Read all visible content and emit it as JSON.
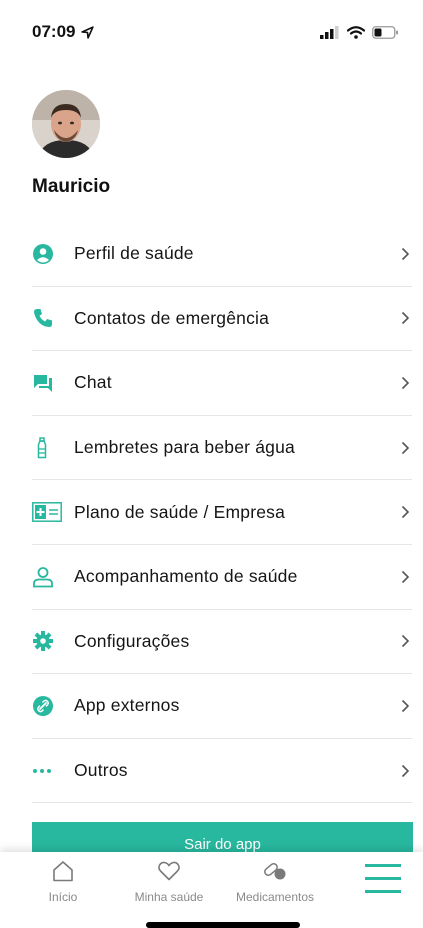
{
  "status_bar": {
    "time": "07:09"
  },
  "profile": {
    "name": "Mauricio"
  },
  "menu": [
    {
      "label": "Perfil de saúde",
      "icon": "person-circle-icon"
    },
    {
      "label": "Contatos de emergência",
      "icon": "phone-icon"
    },
    {
      "label": "Chat",
      "icon": "chat-icon"
    },
    {
      "label": "Lembretes para beber água",
      "icon": "water-bottle-icon"
    },
    {
      "label": "Plano de saúde / Empresa",
      "icon": "health-card-icon"
    },
    {
      "label": "Acompanhamento de saúde",
      "icon": "person-outline-icon"
    },
    {
      "label": "Configurações",
      "icon": "gear-icon"
    },
    {
      "label": "App externos",
      "icon": "link-icon"
    },
    {
      "label": "Outros",
      "icon": "more-dots-icon"
    }
  ],
  "logout": {
    "label": "Sair do app"
  },
  "tabs": [
    {
      "label": "Início",
      "icon": "home-icon"
    },
    {
      "label": "Minha saúde",
      "icon": "heart-icon"
    },
    {
      "label": "Medicamentos",
      "icon": "pill-icon"
    },
    {
      "label": "",
      "icon": "menu-icon"
    }
  ],
  "colors": {
    "accent": "#28b89f",
    "text": "#151515",
    "tab_inactive": "#8a8a8a"
  }
}
